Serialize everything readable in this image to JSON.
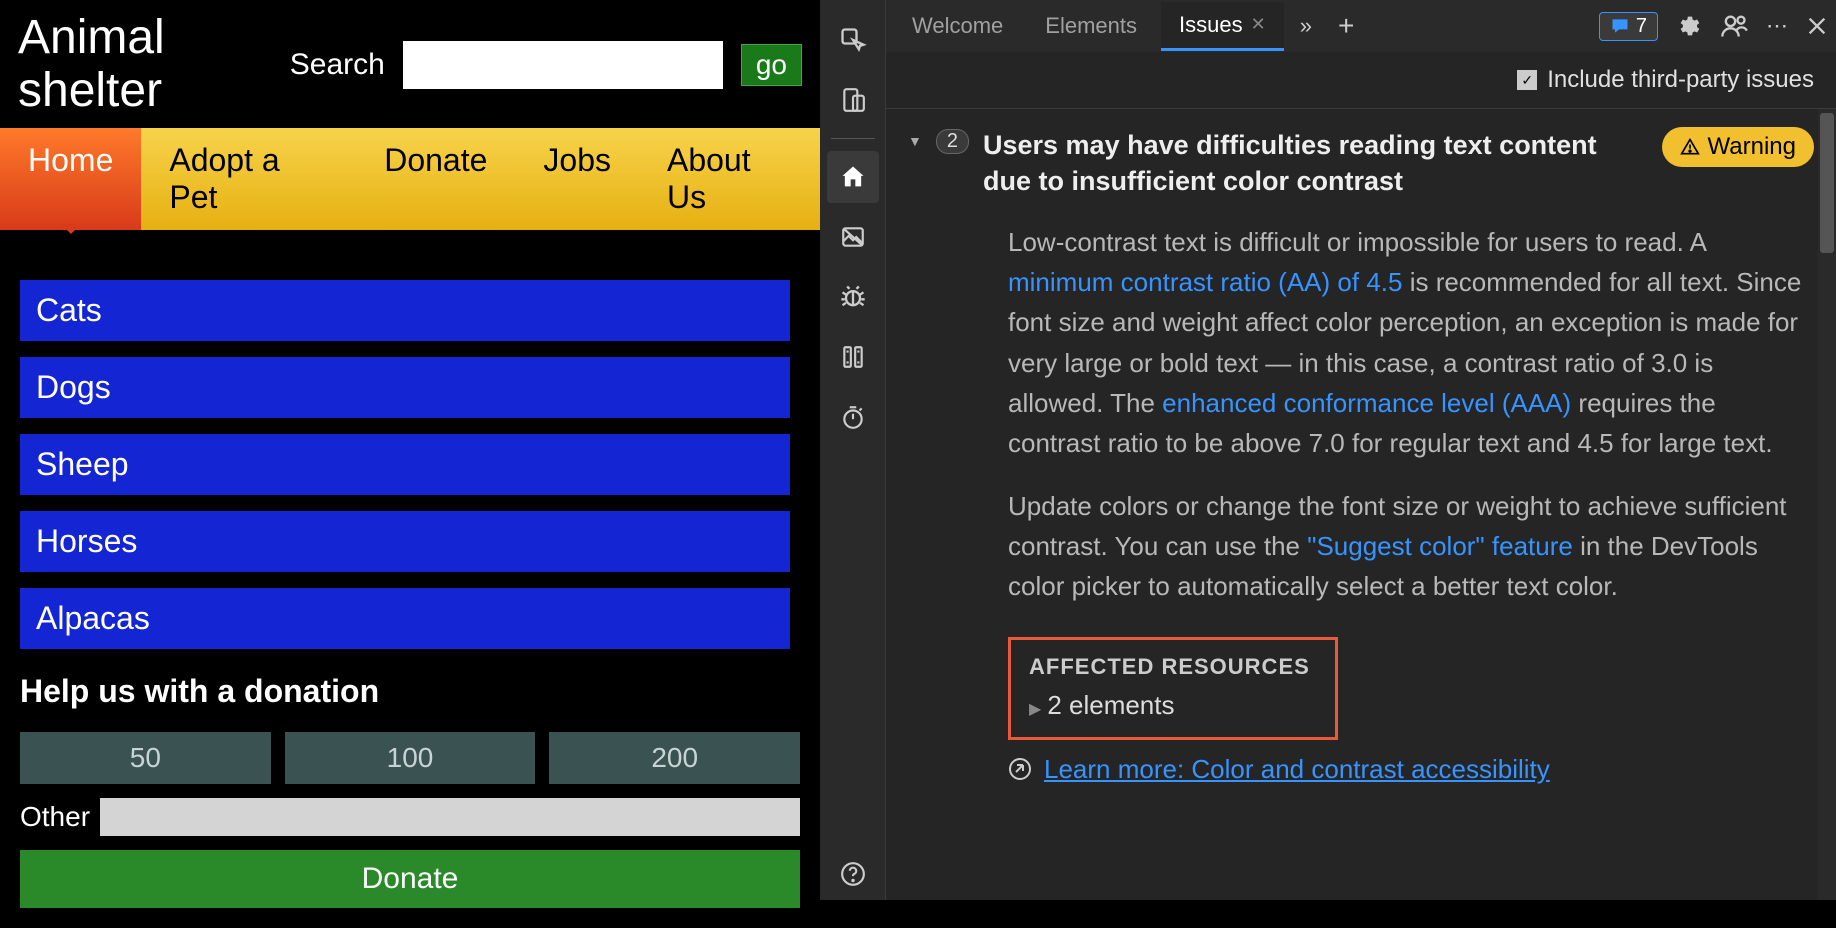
{
  "app": {
    "title": "Animal shelter",
    "search_label": "Search",
    "go_label": "go",
    "nav": [
      "Home",
      "Adopt a Pet",
      "Donate",
      "Jobs",
      "About Us"
    ],
    "active_nav": 0,
    "categories": [
      "Cats",
      "Dogs",
      "Sheep",
      "Horses",
      "Alpacas"
    ],
    "donation": {
      "heading": "Help us with a donation",
      "amounts": [
        "50",
        "100",
        "200"
      ],
      "other_label": "Other",
      "donate_label": "Donate"
    }
  },
  "devtools": {
    "tabs": [
      "Welcome",
      "Elements",
      "Issues"
    ],
    "active_tab": 2,
    "feedback_count": "7",
    "toolbar": {
      "third_party_label": "Include third-party issues",
      "third_party_checked": true
    },
    "issue": {
      "count": "2",
      "title": "Users may have difficulties reading text content due to insufficient color contrast",
      "severity": "Warning",
      "para1_a": "Low-contrast text is difficult or impossible for users to read. A ",
      "para1_link1": "minimum contrast ratio (AA) of 4.5",
      "para1_b": " is recommended for all text. Since font size and weight affect color perception, an exception is made for very large or bold text — in this case, a contrast ratio of 3.0 is allowed. The ",
      "para1_link2": "enhanced conformance level (AAA)",
      "para1_c": " requires the contrast ratio to be above 7.0 for regular text and 4.5 for large text.",
      "para2_a": "Update colors or change the font size or weight to achieve sufficient contrast. You can use the ",
      "para2_link1": "\"Suggest color\" feature",
      "para2_b": " in the DevTools color picker to automatically select a better text color.",
      "affected_heading": "AFFECTED RESOURCES",
      "affected_sub": "2 elements",
      "learn_more": "Learn more: Color and contrast accessibility"
    }
  }
}
